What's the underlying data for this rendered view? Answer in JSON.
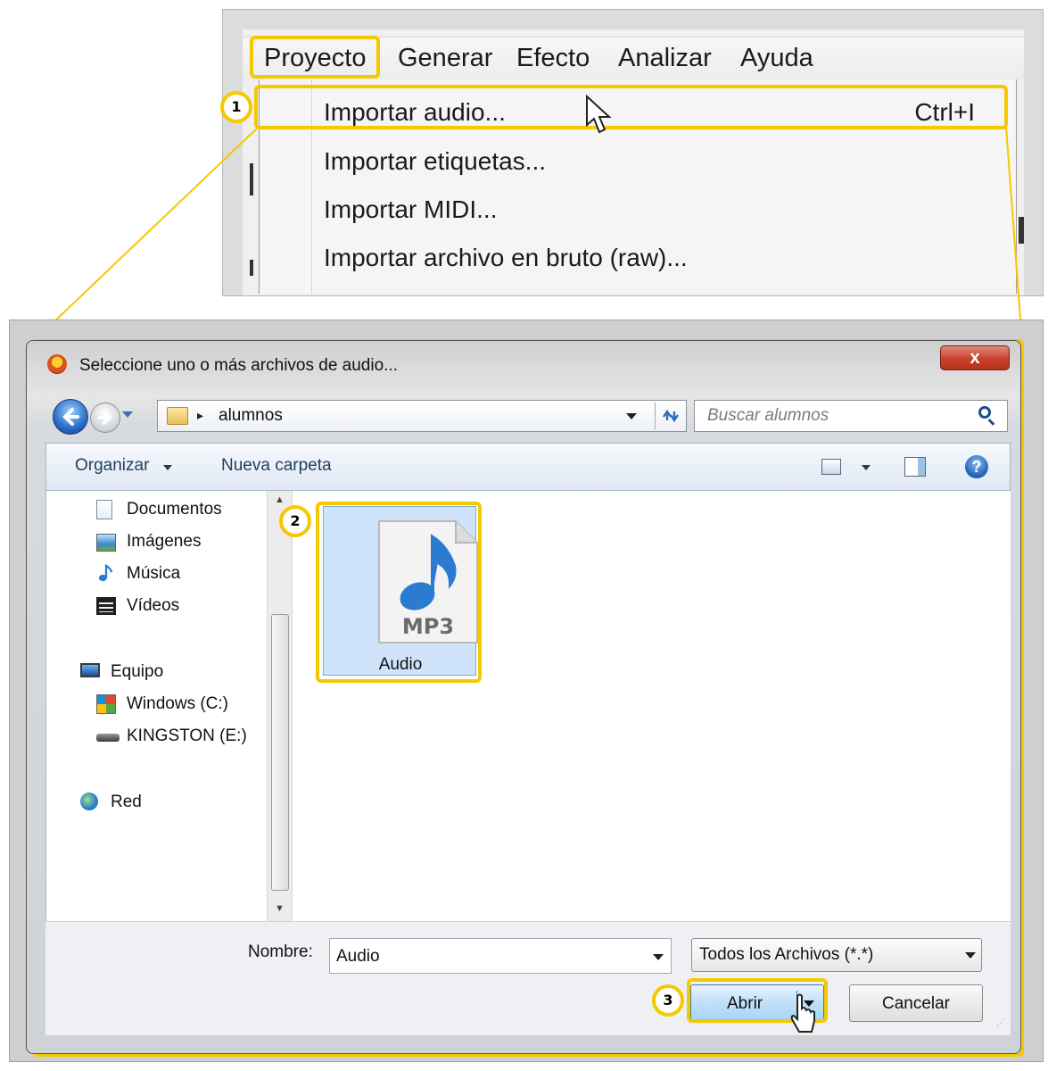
{
  "menu": {
    "bar_items": [
      "Proyecto",
      "Generar",
      "Efecto",
      "Analizar",
      "Ayuda"
    ],
    "items": [
      {
        "label": "Importar audio...",
        "shortcut": "Ctrl+I"
      },
      {
        "label": "Importar etiquetas..."
      },
      {
        "label": "Importar MIDI..."
      },
      {
        "label": "Importar archivo en bruto (raw)..."
      }
    ]
  },
  "dialog": {
    "title": "Seleccione uno o más archivos de audio...",
    "close_label": "x",
    "address": "alumnos",
    "address_sep": "▸",
    "search_placeholder": "Buscar alumnos",
    "toolbar": {
      "organize": "Organizar",
      "new_folder": "Nueva carpeta",
      "help": "?"
    },
    "nav": {
      "libraries": [
        "Documentos",
        "Imágenes",
        "Música",
        "Vídeos"
      ],
      "computer": "Equipo",
      "drives": [
        "Windows (C:)",
        "KINGSTON (E:)"
      ],
      "network": "Red"
    },
    "file": {
      "name": "Audio",
      "type_label": "MP3"
    },
    "bottom": {
      "name_label": "Nombre:",
      "name_value": "Audio",
      "filter": "Todos los Archivos (*.*)",
      "open": "Abrir",
      "cancel": "Cancelar"
    }
  },
  "callouts": [
    "1",
    "2",
    "3"
  ],
  "colors": {
    "highlight": "#f5c800",
    "selection": "#cfe4fb",
    "accent": "#2a6cc8"
  }
}
